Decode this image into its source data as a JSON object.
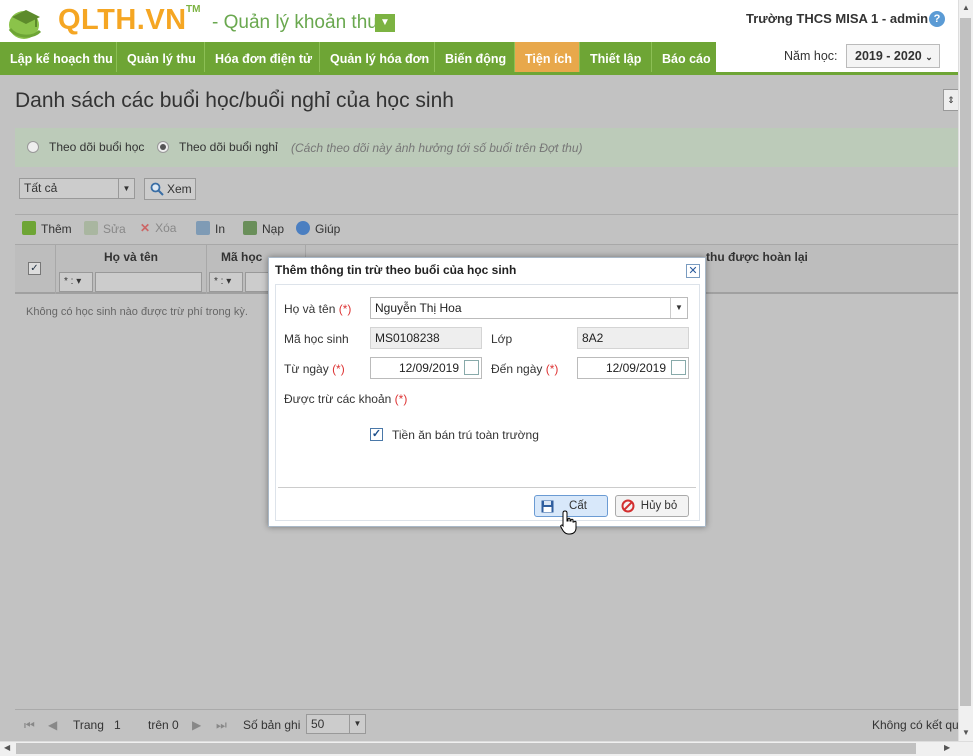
{
  "header": {
    "logo_text": "QLTH.VN",
    "logo_tm": "TM",
    "subtitle": "- Quản lý khoản thu",
    "user_info": "Trường THCS MISA 1 - admin ▾",
    "help": "?"
  },
  "nav": {
    "items": [
      "Lập kế hoạch thu",
      "Quản lý thu",
      "Hóa đơn điện tử",
      "Quản lý hóa đơn",
      "Biến động",
      "Tiện ích",
      "Thiết lập",
      "Báo cáo"
    ],
    "active": "Tiện ích",
    "year_label": "Năm học:",
    "year_value": "2019 - 2020"
  },
  "page": {
    "title": "Danh sách các buổi học/buổi nghỉ của học sinh",
    "mode_options": [
      "Theo dõi buổi học",
      "Theo dõi buổi nghỉ"
    ],
    "mode_selected": "Theo dõi buổi nghỉ",
    "mode_hint": "(Cách theo dõi này ảnh hưởng tới số buổi trên Đợt thu)",
    "filter_value": "Tất cả",
    "view_label": "Xem"
  },
  "toolbar": {
    "add": "Thêm",
    "edit": "Sửa",
    "delete": "Xóa",
    "print": "In",
    "load": "Nạp",
    "help": "Giúp"
  },
  "grid": {
    "columns": [
      "Họ và tên",
      "Mã học",
      "thu được hoàn lại"
    ],
    "filter_op": "* :",
    "empty_message": "Không có học sinh nào được trừ phí trong kỳ."
  },
  "pager": {
    "page_label": "Trang",
    "page_value": "1",
    "of_label": "trên 0",
    "records_label": "Số bản ghi",
    "page_size": "50",
    "status": "Không có kết quả"
  },
  "dialog": {
    "title": "Thêm thông tin trừ theo buổi của học sinh",
    "name_label": "Họ và tên",
    "name_value": "Nguyễn Thị Hoa",
    "student_id_label": "Mã học sinh",
    "student_id_value": "MS0108238",
    "class_label": "Lớp",
    "class_value": "8A2",
    "from_label": "Từ ngày",
    "from_value": "12/09/2019",
    "to_label": "Đến ngày",
    "to_value": "12/09/2019",
    "fees_label": "Được trừ các khoản",
    "required_mark": "(*)",
    "fee_item": "Tiền ăn bán trú toàn trường",
    "fee_checked": true,
    "save_label": "Cất",
    "cancel_label": "Hủy bỏ"
  },
  "colors": {
    "nav_green": "#6ea535",
    "nav_active": "#e8a84b",
    "logo_orange": "#f5a623"
  }
}
